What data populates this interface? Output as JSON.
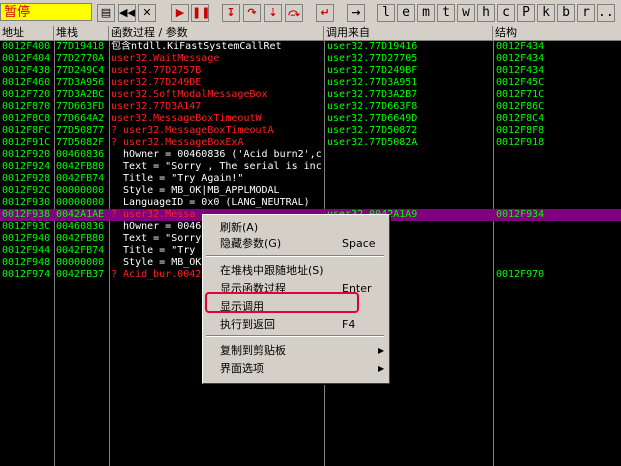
{
  "toolbar": {
    "status": "暂停",
    "status_color": "#ffff00",
    "buttons": [
      {
        "name": "open-icon",
        "glyph": "▤"
      },
      {
        "name": "restart-icon",
        "glyph": "◀◀"
      },
      {
        "name": "close-icon",
        "glyph": "✕"
      },
      {
        "name": "run-icon",
        "glyph": "▶"
      },
      {
        "name": "pause-icon",
        "glyph": "❚❚"
      },
      {
        "name": "step-into-icon",
        "glyph": "↧"
      },
      {
        "name": "step-over-icon",
        "glyph": "↷"
      },
      {
        "name": "trace-into-icon",
        "glyph": "⇣"
      },
      {
        "name": "trace-over-icon",
        "glyph": "⤼"
      },
      {
        "name": "execute-till-return-icon",
        "glyph": "↵"
      },
      {
        "name": "goto-icon",
        "glyph": "→"
      }
    ],
    "letters": [
      "l",
      "e",
      "m",
      "t",
      "w",
      "h",
      "c",
      "P",
      "k",
      "b",
      "r",
      "..."
    ]
  },
  "columns": [
    "地址",
    "堆栈",
    "函数过程 / 参数",
    "调用来自",
    "结构"
  ],
  "rows": [
    {
      "addr": "0012F400",
      "stack": "77D19418",
      "proc": "包含ntdll.KiFastSystemCallRet",
      "from": "user32.77D19416",
      "frame": "0012F434",
      "proc_color": "mixed"
    },
    {
      "addr": "0012F404",
      "stack": "77D2770A",
      "proc": "user32.WaitMessage",
      "from": "user32.77D27705",
      "frame": "0012F434",
      "proc_color": "red"
    },
    {
      "addr": "0012F438",
      "stack": "77D249C4",
      "proc": "user32.77D2757B",
      "from": "user32.77D249BF",
      "frame": "0012F434",
      "proc_color": "red"
    },
    {
      "addr": "0012F460",
      "stack": "77D3A956",
      "proc": "user32.77D249DE",
      "from": "user32.77D3A951",
      "frame": "0012F45C",
      "proc_color": "red"
    },
    {
      "addr": "0012F720",
      "stack": "77D3A2BC",
      "proc": "user32.SoftModalMessageBox",
      "from": "user32.77D3A2B7",
      "frame": "0012F71C",
      "proc_color": "red"
    },
    {
      "addr": "0012F870",
      "stack": "77D663FD",
      "proc": "user32.77D3A147",
      "from": "user32.77D663F8",
      "frame": "0012F86C",
      "proc_color": "red"
    },
    {
      "addr": "0012F8C8",
      "stack": "77D664A2",
      "proc": "user32.MessageBoxTimeoutW",
      "from": "user32.77D6649D",
      "frame": "0012F8C4",
      "proc_color": "red"
    },
    {
      "addr": "0012F8FC",
      "stack": "77D50877",
      "proc": "? user32.MessageBoxTimeoutA",
      "from": "user32.77D50872",
      "frame": "0012F8F8",
      "proc_color": "red"
    },
    {
      "addr": "0012F91C",
      "stack": "77D5082F",
      "proc": "? user32.MessageBoxExA",
      "from": "user32.77D5082A",
      "frame": "0012F918",
      "proc_color": "red"
    },
    {
      "addr": "0012F920",
      "stack": "00460836",
      "proc": "  hOwner = 00460836 ('Acid burn2',c",
      "from": "",
      "frame": "",
      "proc_color": "white"
    },
    {
      "addr": "0012F924",
      "stack": "0042FB80",
      "proc": "  Text = \"Sorry , The serial is inco",
      "from": "",
      "frame": "",
      "proc_color": "white"
    },
    {
      "addr": "0012F928",
      "stack": "0042FB74",
      "proc": "  Title = \"Try Again!\"",
      "from": "",
      "frame": "",
      "proc_color": "white"
    },
    {
      "addr": "0012F92C",
      "stack": "00000000",
      "proc": "  Style = MB_OK|MB_APPLMODAL",
      "from": "",
      "frame": "",
      "proc_color": "white"
    },
    {
      "addr": "0012F930",
      "stack": "00000000",
      "proc": "  LanguageID = 0x0 (LANG_NEUTRAL)",
      "from": "",
      "frame": "",
      "proc_color": "white"
    },
    {
      "addr": "0012F938",
      "stack": "0042A1AE",
      "proc": "? user32.Messa",
      "from": "user32.0042A1A9",
      "frame": "0012F934",
      "proc_color": "red",
      "selected": true
    },
    {
      "addr": "0012F93C",
      "stack": "00460836",
      "proc": "  hOwner = 0046",
      "from": "",
      "frame": "",
      "proc_color": "white"
    },
    {
      "addr": "0012F940",
      "stack": "0042FB80",
      "proc": "  Text = \"Sorry",
      "from": "",
      "frame": "",
      "proc_color": "white"
    },
    {
      "addr": "0012F944",
      "stack": "0042FB74",
      "proc": "  Title = \"Try",
      "from": "",
      "frame": "",
      "proc_color": "white"
    },
    {
      "addr": "0012F948",
      "stack": "00000000",
      "proc": "  Style = MB_OK",
      "from": "",
      "frame": "",
      "proc_color": "white"
    },
    {
      "addr": "0012F974",
      "stack": "0042FB37",
      "proc": "? Acid_bur.0042",
      "from": "0042FB32",
      "frame": "0012F970",
      "proc_color": "red"
    }
  ],
  "context_menu": {
    "items": [
      {
        "label": "刷新(A)",
        "key": "",
        "arrow": false
      },
      {
        "label": "隐藏参数(G)",
        "key": "Space",
        "arrow": false
      },
      {
        "sep": true
      },
      {
        "label": "在堆栈中跟随地址(S)",
        "key": "",
        "arrow": false
      },
      {
        "label": "显示函数过程",
        "key": "Enter",
        "arrow": false
      },
      {
        "label": "显示调用",
        "key": "",
        "arrow": false
      },
      {
        "label": "执行到返回",
        "key": "F4",
        "arrow": false
      },
      {
        "sep": true
      },
      {
        "label": "复制到剪贴板",
        "key": "",
        "arrow": true
      },
      {
        "label": "界面选项",
        "key": "",
        "arrow": true
      }
    ]
  },
  "colors": {
    "green": "#00ff00",
    "red": "#ff2020",
    "white": "#ffffff",
    "selected_bg": "#800080",
    "highlight": "#e0003c"
  }
}
